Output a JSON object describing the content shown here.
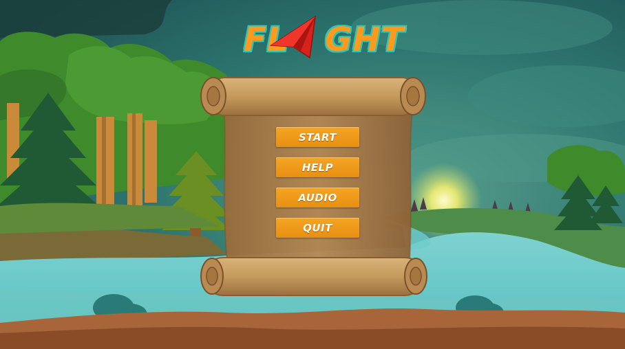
{
  "title": {
    "left_text": "FL",
    "right_text": "GHT",
    "icon": "paper-plane-icon"
  },
  "menu": {
    "buttons": [
      {
        "label": "START"
      },
      {
        "label": "HELP"
      },
      {
        "label": "AUDIO"
      },
      {
        "label": "QUIT"
      }
    ]
  },
  "colors": {
    "button": "#f0a022",
    "title_fill": "#ff9a1f",
    "title_outline": "#2fc6b6",
    "plane": "#d9221c"
  }
}
